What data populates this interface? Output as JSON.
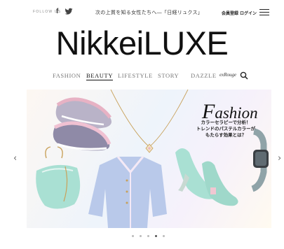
{
  "header": {
    "follow_label": "FOLLOW US",
    "facebook_glyph": "f",
    "tagline": "次の上質を知る女性たちへ―「日経リュクス」",
    "member_link": "会員登録",
    "login_link": "ログイン"
  },
  "logo": "NikkeiLUXE",
  "nav": {
    "items": [
      "FASHION",
      "BEAUTY",
      "LIFESTYLE",
      "STORY",
      "DAZZLE",
      "exRouge"
    ],
    "active": "BEAUTY"
  },
  "hero": {
    "title_initial": "F",
    "title_rest": "ashion",
    "caption_lines": [
      "カラーセラピーで分析！",
      "トレンドのパステルカラーが",
      "もたらす効果とは？"
    ]
  },
  "carousel": {
    "prev_glyph": "‹",
    "next_glyph": "›",
    "dot_count": 5,
    "active_index": 3
  },
  "colors": {
    "accent": "#111111",
    "pastel_mint": "#a9e0d3",
    "pastel_blue": "#b9c9ea",
    "pastel_pink": "#f1c7d2"
  }
}
